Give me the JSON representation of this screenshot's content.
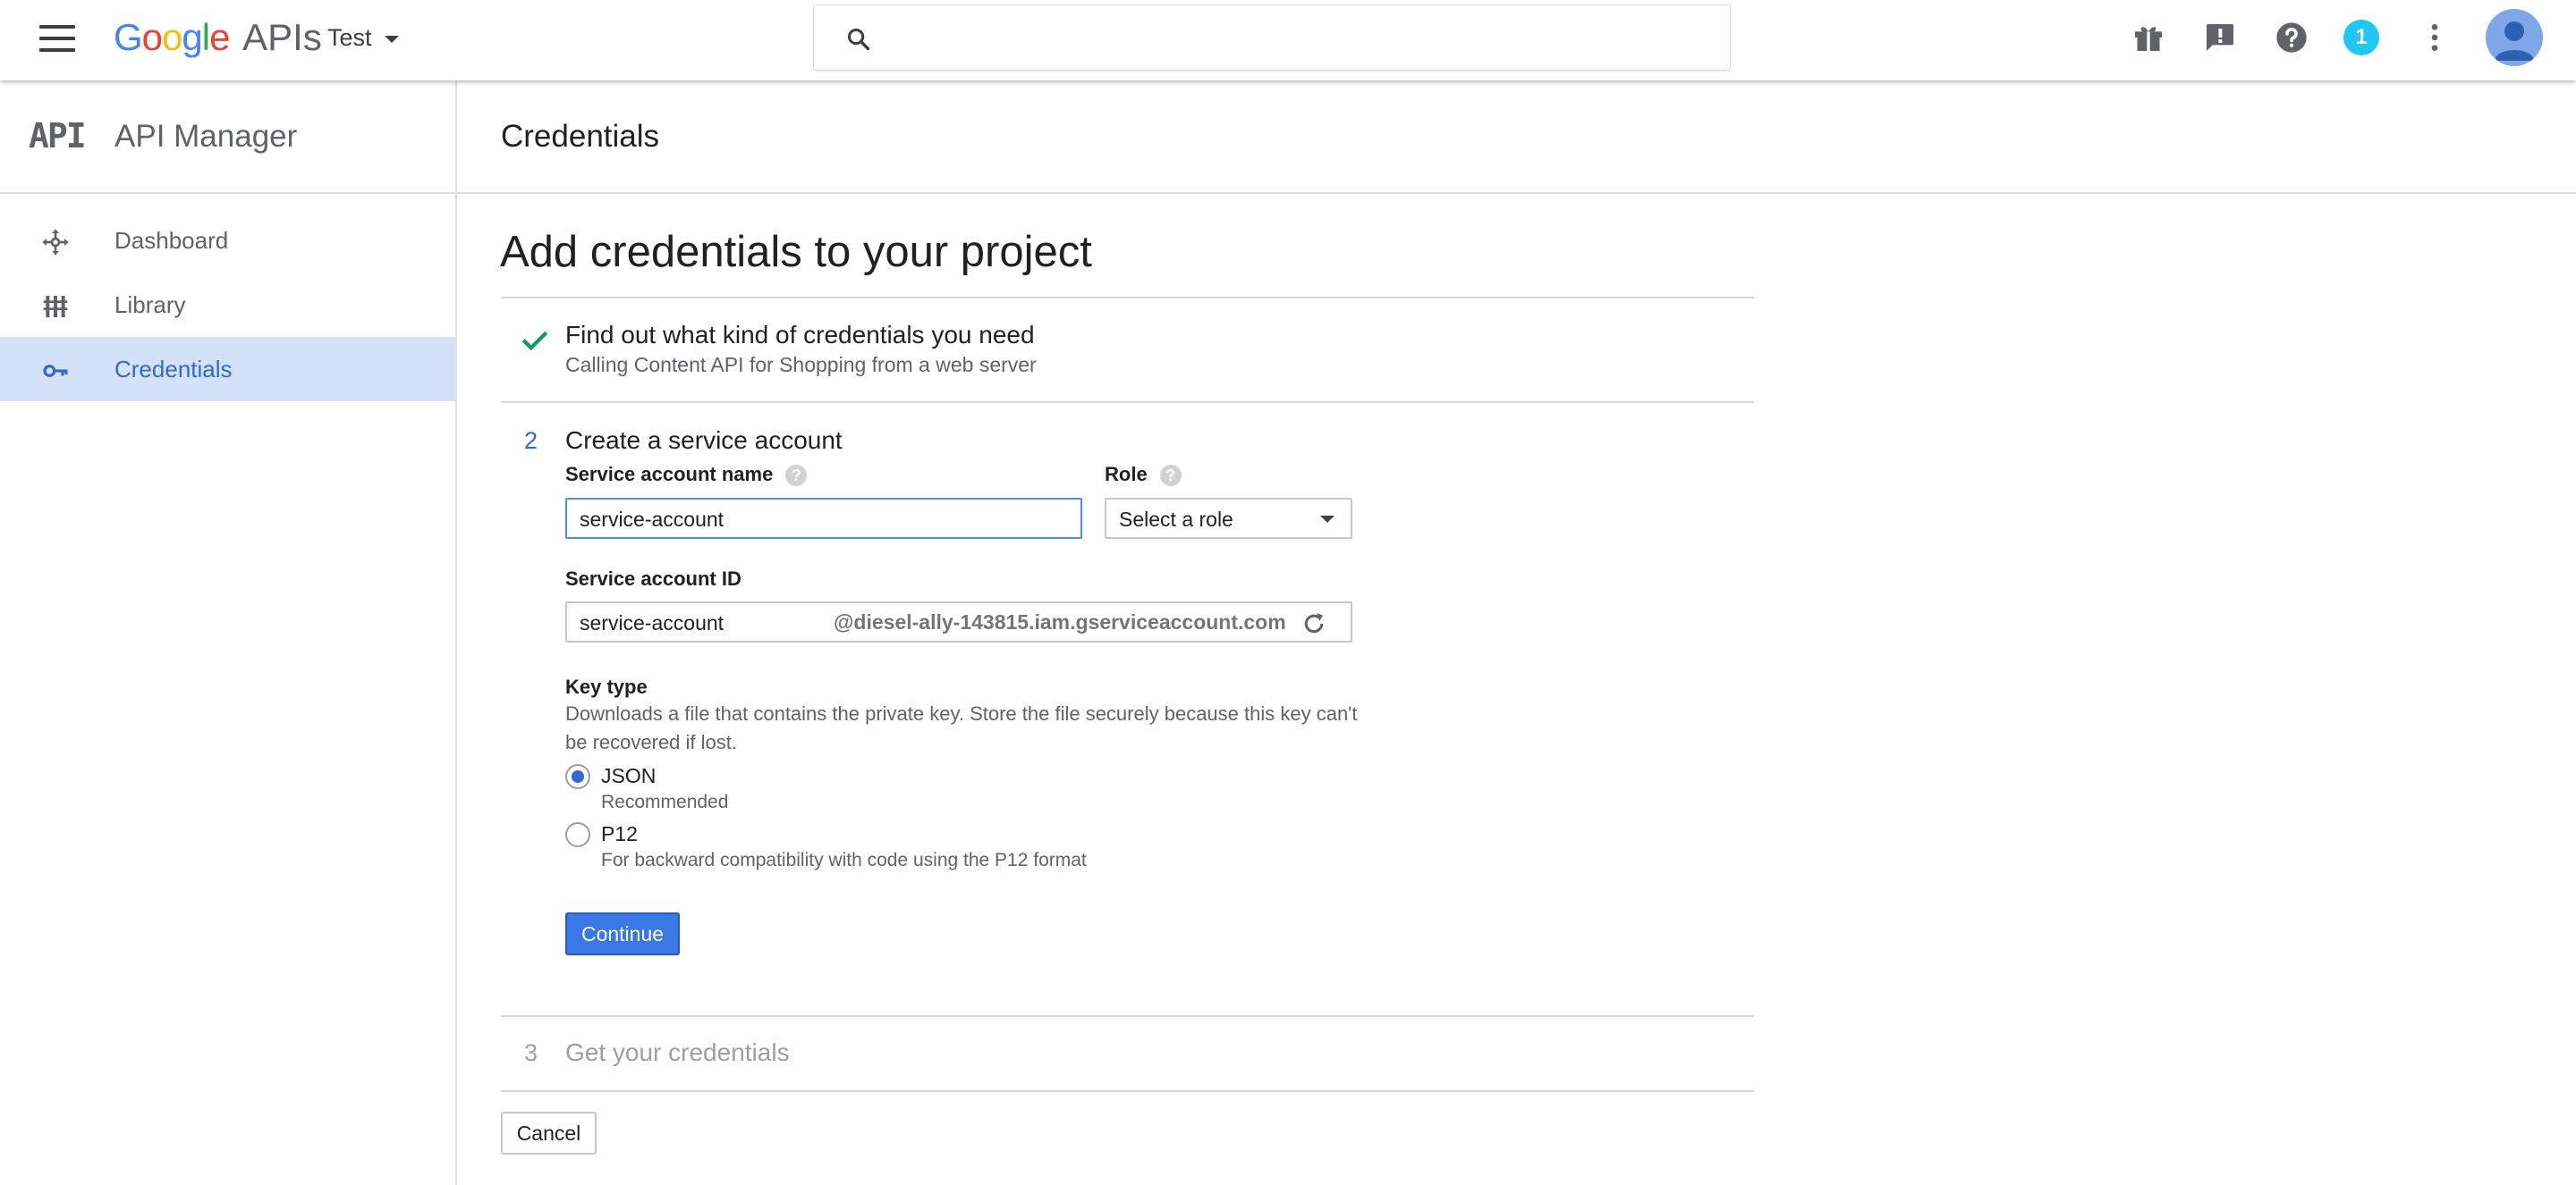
{
  "topbar": {
    "logo_g": [
      "G",
      "o",
      "o",
      "g",
      "l",
      "e"
    ],
    "logo_apis": "APIs",
    "project": "Test",
    "search_placeholder": "",
    "notification_count": "1"
  },
  "sidebar": {
    "logo_text": "API",
    "title": "API Manager",
    "items": [
      {
        "label": "Dashboard",
        "icon": "dashboard-icon"
      },
      {
        "label": "Library",
        "icon": "library-icon"
      },
      {
        "label": "Credentials",
        "icon": "key-icon",
        "active": true
      }
    ]
  },
  "main": {
    "header_title": "Credentials",
    "page_heading": "Add credentials to your project",
    "step1": {
      "title": "Find out what kind of credentials you need",
      "subtitle": "Calling Content API for Shopping from a web server"
    },
    "step2": {
      "number": "2",
      "title": "Create a service account",
      "name_label": "Service account name",
      "name_value": "service-account",
      "role_label": "Role",
      "role_value": "Select a role",
      "id_label": "Service account ID",
      "id_value": "service-account",
      "id_suffix": "@diesel-ally-143815.iam.gserviceaccount.com",
      "key_type_label": "Key type",
      "key_type_desc": "Downloads a file that contains the private key. Store the file securely because this key can't be recovered if lost.",
      "options": [
        {
          "label": "JSON",
          "sub": "Recommended",
          "checked": true
        },
        {
          "label": "P12",
          "sub": "For backward compatibility with code using the P12 format",
          "checked": false
        }
      ],
      "continue_label": "Continue"
    },
    "step3": {
      "number": "3",
      "title": "Get your credentials"
    },
    "cancel_label": "Cancel"
  },
  "colors": {
    "accent": "#3367d6",
    "active_nav_bg": "#d5e3f8",
    "check_green": "#0f9d58",
    "badge": "#1ec8f0"
  }
}
